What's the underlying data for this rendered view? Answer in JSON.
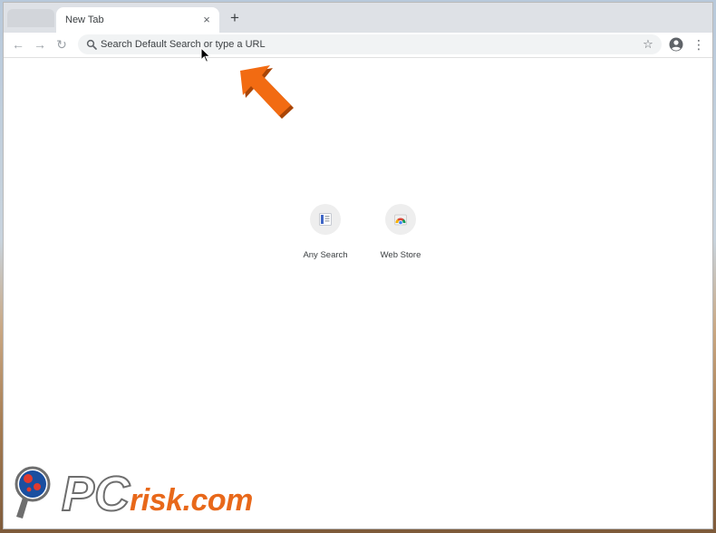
{
  "browser": {
    "tab": {
      "title": "New Tab",
      "close_icon": "×"
    },
    "new_tab_icon": "+",
    "nav": {
      "back_icon": "←",
      "forward_icon": "→",
      "reload_icon": "↻"
    },
    "omnibox": {
      "placeholder": "Search Default Search or type a URL",
      "star_icon": "☆"
    },
    "menu_icon": "⋮"
  },
  "shortcuts": [
    {
      "label": "Any Search",
      "icon": "document-icon"
    },
    {
      "label": "Web Store",
      "icon": "web-store-icon"
    }
  ],
  "overlay": {
    "arrow_color": "#f26b12",
    "watermark": {
      "pc": "PC",
      "rest": "risk.com"
    }
  }
}
